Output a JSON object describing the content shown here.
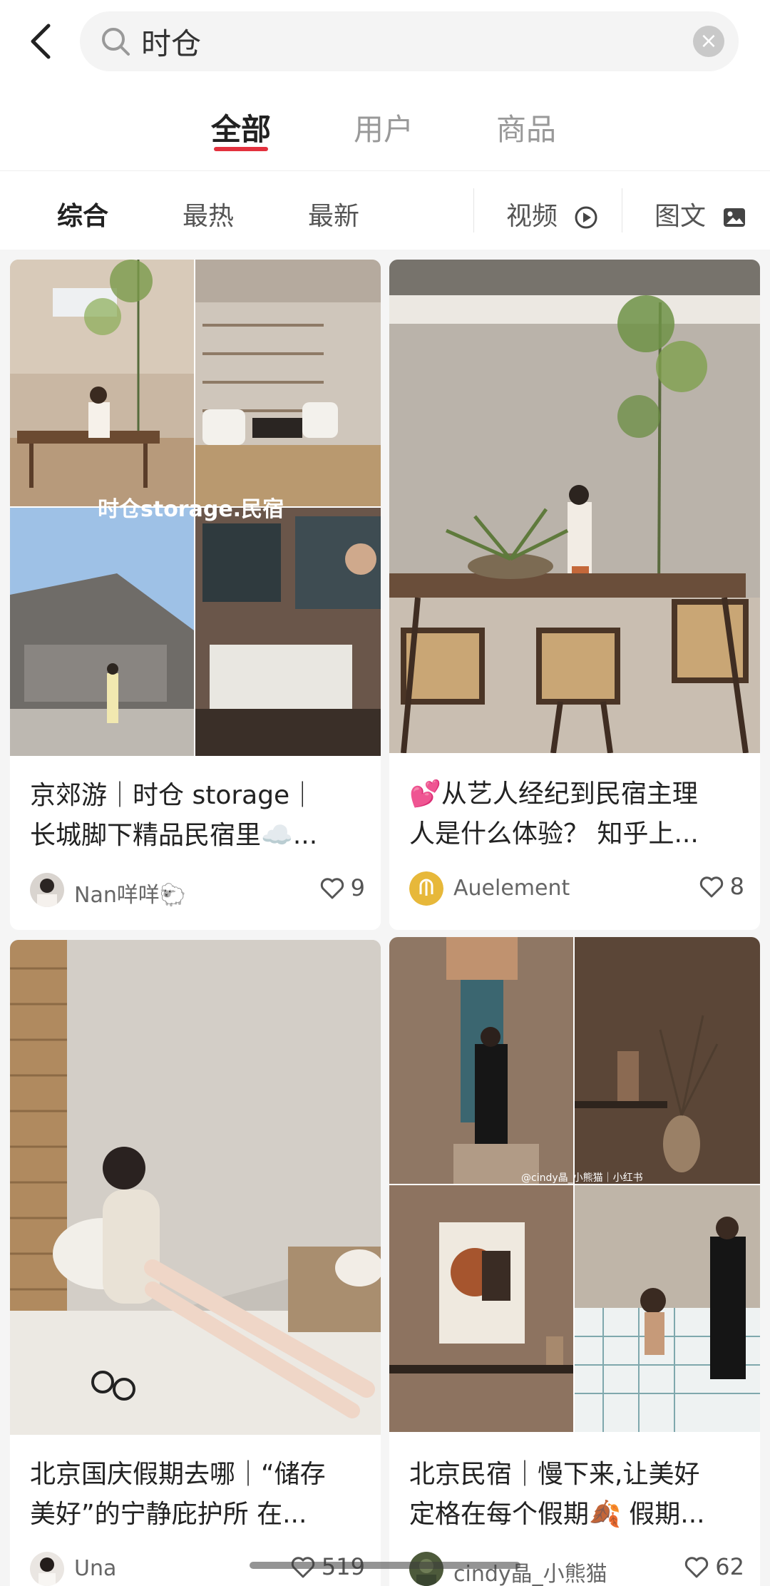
{
  "search": {
    "query": "时仓"
  },
  "tabs": [
    "全部",
    "用户",
    "商品"
  ],
  "filters": {
    "sort": [
      "综合",
      "最热",
      "最新"
    ],
    "video": "视频",
    "image_text": "图文"
  },
  "accent": "#e3313e",
  "cards": [
    {
      "title_line1": "京郊游｜时仓 storage｜",
      "title_line2": "长城脚下精品民宿里☁️...",
      "image_caption": "时仓storage.民宿",
      "author": "Nan咩咩🐑",
      "likes": "9"
    },
    {
      "title_line1": "💕从艺人经纪到民宿主理",
      "title_line2": "人是什么体验？ 知乎上...",
      "author": "Auelement",
      "likes": "8"
    },
    {
      "title_line1": "北京国庆假期去哪｜“储存",
      "title_line2": "美好”的宁静庇护所 在...",
      "author": "Una",
      "likes": "519"
    },
    {
      "title_line1": "北京民宿｜慢下来,让美好",
      "title_line2": "定格在每个假期🍂 假期...",
      "image_caption": "@cindy晶_小熊猫｜小红书",
      "author": "cindy晶_小熊猫",
      "likes": "62"
    }
  ]
}
